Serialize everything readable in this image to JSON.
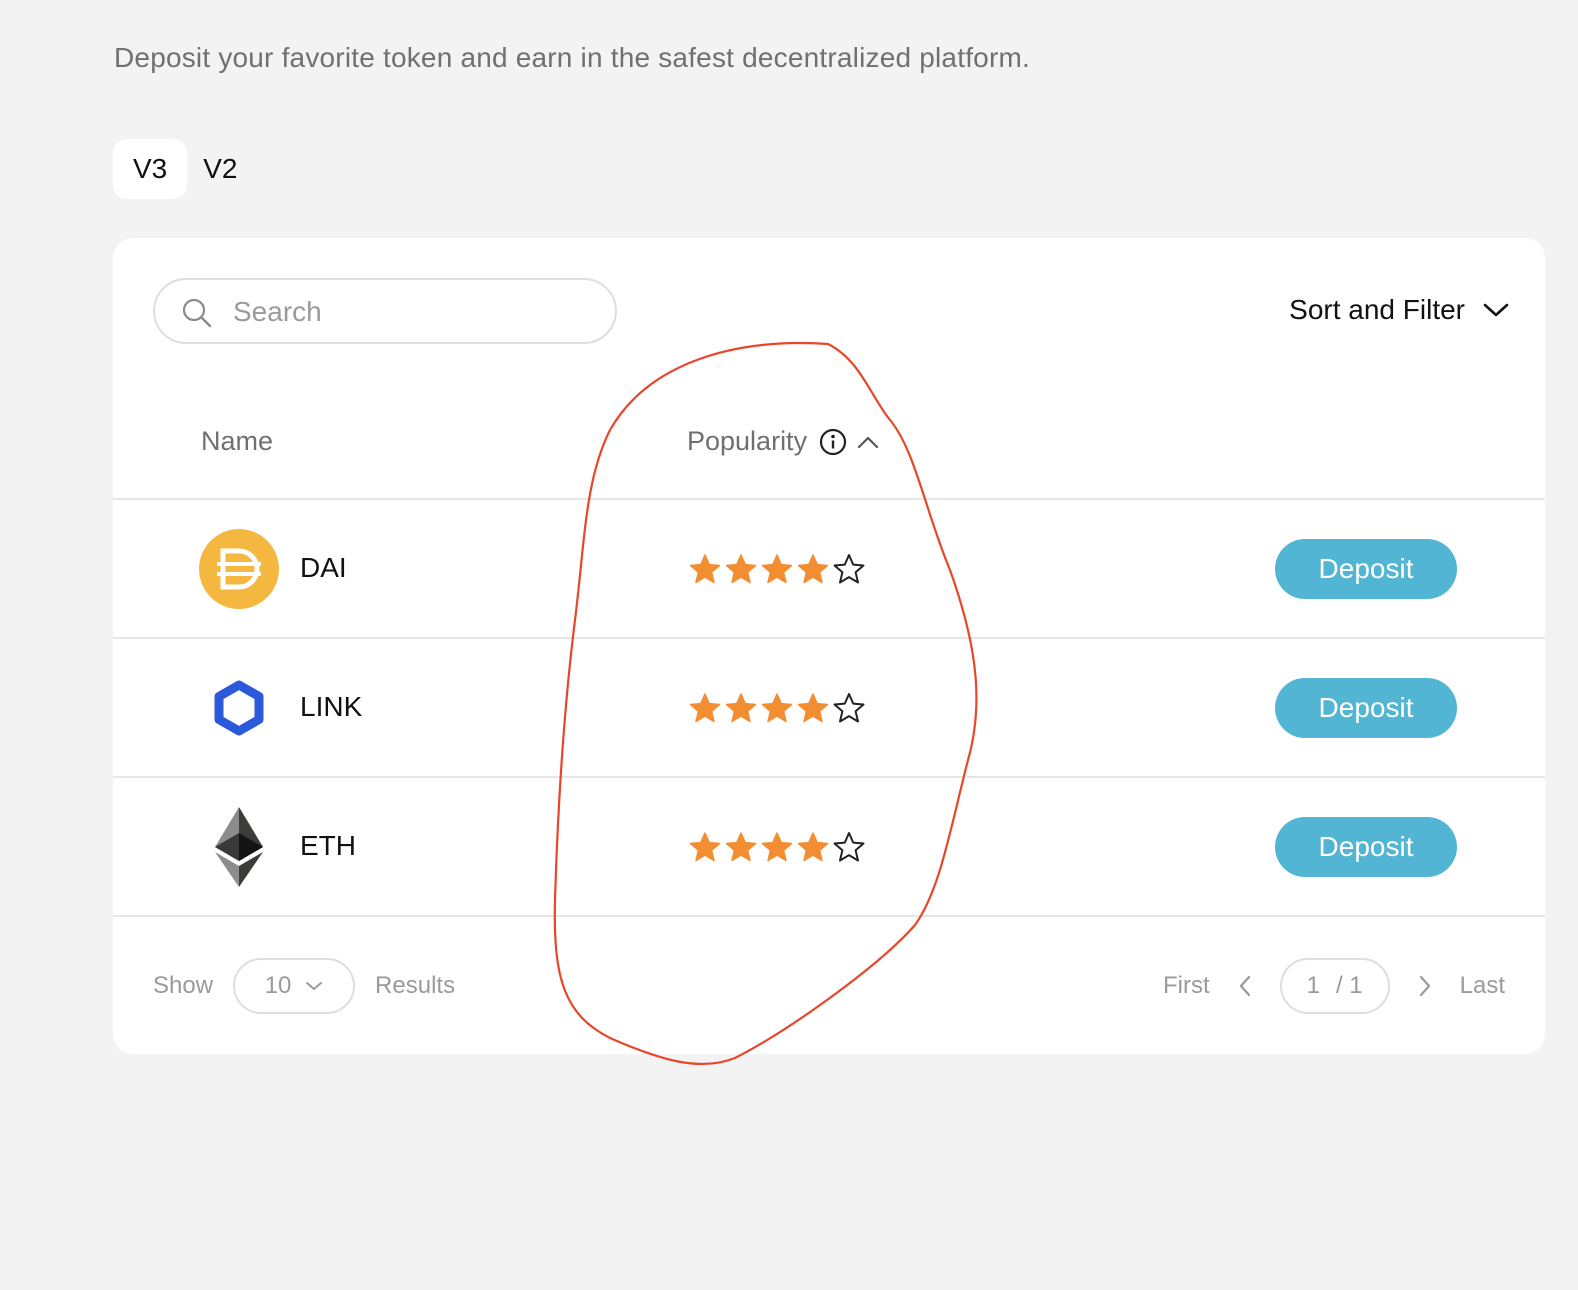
{
  "subtitle": "Deposit your favorite token and earn in the safest decentralized platform.",
  "tabs": [
    {
      "label": "V3",
      "active": true
    },
    {
      "label": "V2",
      "active": false
    }
  ],
  "search": {
    "placeholder": "Search"
  },
  "sort_filter": {
    "label": "Sort and Filter"
  },
  "table": {
    "headers": {
      "name": "Name",
      "popularity": "Popularity"
    },
    "rows": [
      {
        "token": "DAI",
        "icon": "dai-icon",
        "rating": 4,
        "max_rating": 5,
        "action": "Deposit"
      },
      {
        "token": "LINK",
        "icon": "chainlink-icon",
        "rating": 4,
        "max_rating": 5,
        "action": "Deposit"
      },
      {
        "token": "ETH",
        "icon": "ethereum-icon",
        "rating": 4,
        "max_rating": 5,
        "action": "Deposit"
      }
    ]
  },
  "footer": {
    "show_label": "Show",
    "page_size": "10",
    "results_label": "Results",
    "first_label": "First",
    "last_label": "Last",
    "current_page": "1",
    "total_pages": "/ 1"
  },
  "colors": {
    "star_filled": "#f28d31",
    "deposit_button": "#52b5d3",
    "annotation_stroke": "#e8462a",
    "dai": "#f4b73f",
    "link": "#2a5ada"
  }
}
